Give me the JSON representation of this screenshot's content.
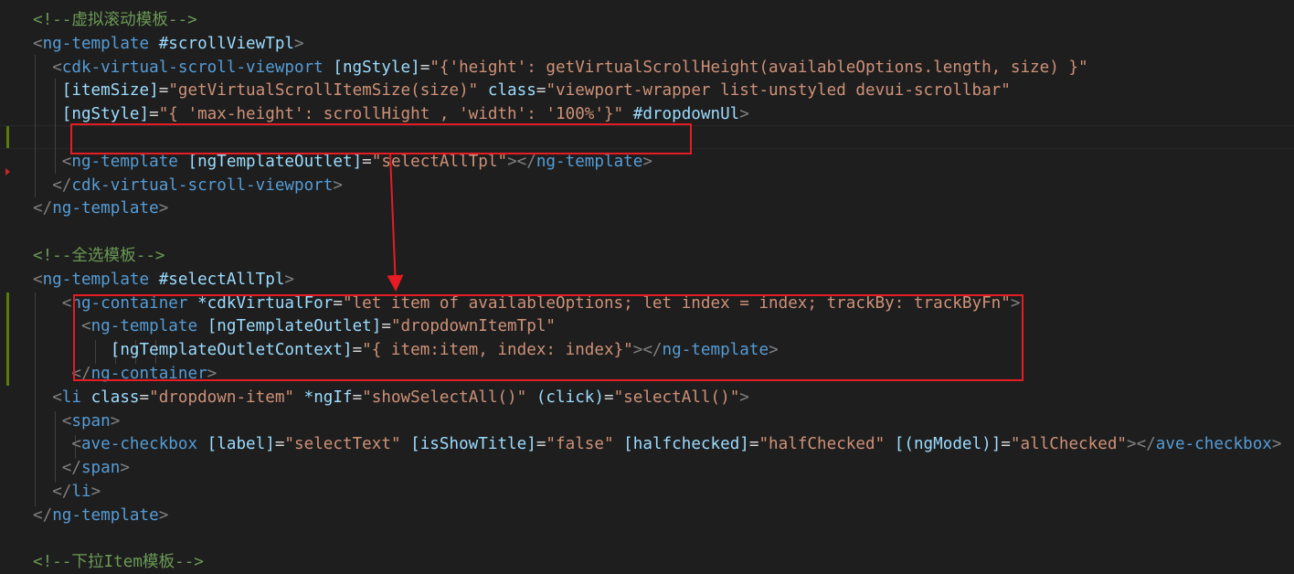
{
  "editor": {
    "lines": [
      [
        {
          "c": "c",
          "t": "<!--虚拟滚动模板-->"
        }
      ],
      [
        {
          "c": "pn",
          "t": "<"
        },
        {
          "c": "tg",
          "t": "ng-template"
        },
        {
          "c": "tx",
          "t": " "
        },
        {
          "c": "at",
          "t": "#scrollViewTpl"
        },
        {
          "c": "pn",
          "t": ">"
        }
      ],
      [
        {
          "c": "tx",
          "t": "  "
        },
        {
          "c": "pn",
          "t": "<"
        },
        {
          "c": "tg",
          "t": "cdk-virtual-scroll-viewport"
        },
        {
          "c": "tx",
          "t": " "
        },
        {
          "c": "at",
          "t": "[ngStyle]"
        },
        {
          "c": "tx",
          "t": "="
        },
        {
          "c": "st",
          "t": "\"{'height': getVirtualScrollHeight(availableOptions.length, size) }\""
        }
      ],
      [
        {
          "c": "tx",
          "t": "   "
        },
        {
          "c": "at",
          "t": "[itemSize]"
        },
        {
          "c": "tx",
          "t": "="
        },
        {
          "c": "st",
          "t": "\"getVirtualScrollItemSize(size)\""
        },
        {
          "c": "tx",
          "t": " "
        },
        {
          "c": "at",
          "t": "class"
        },
        {
          "c": "tx",
          "t": "="
        },
        {
          "c": "st",
          "t": "\"viewport-wrapper list-unstyled devui-scrollbar\""
        }
      ],
      [
        {
          "c": "tx",
          "t": "   "
        },
        {
          "c": "at",
          "t": "[ngStyle]"
        },
        {
          "c": "tx",
          "t": "="
        },
        {
          "c": "st",
          "t": "\"{ 'max-height': scrollHight , 'width': '100%'}\""
        },
        {
          "c": "tx",
          "t": " "
        },
        {
          "c": "at",
          "t": "#dropdownUl"
        },
        {
          "c": "pn",
          "t": ">"
        }
      ],
      [
        {
          "c": "tx",
          "t": ""
        }
      ],
      [
        {
          "c": "tx",
          "t": "   "
        },
        {
          "c": "pn",
          "t": "<"
        },
        {
          "c": "tg",
          "t": "ng-template"
        },
        {
          "c": "tx",
          "t": " "
        },
        {
          "c": "at",
          "t": "[ngTemplateOutlet]"
        },
        {
          "c": "tx",
          "t": "="
        },
        {
          "c": "st",
          "t": "\"selectAllTpl\""
        },
        {
          "c": "pn",
          "t": "></"
        },
        {
          "c": "tg",
          "t": "ng-template"
        },
        {
          "c": "pn",
          "t": ">"
        }
      ],
      [
        {
          "c": "tx",
          "t": "  "
        },
        {
          "c": "pn",
          "t": "</"
        },
        {
          "c": "tg",
          "t": "cdk-virtual-scroll-viewport"
        },
        {
          "c": "pn",
          "t": ">"
        }
      ],
      [
        {
          "c": "pn",
          "t": "</"
        },
        {
          "c": "tg",
          "t": "ng-template"
        },
        {
          "c": "pn",
          "t": ">"
        }
      ],
      [
        {
          "c": "tx",
          "t": ""
        }
      ],
      [
        {
          "c": "c",
          "t": "<!--全选模板-->"
        }
      ],
      [
        {
          "c": "pn",
          "t": "<"
        },
        {
          "c": "tg",
          "t": "ng-template"
        },
        {
          "c": "tx",
          "t": " "
        },
        {
          "c": "at",
          "t": "#selectAllTpl"
        },
        {
          "c": "pn",
          "t": ">"
        }
      ],
      [
        {
          "c": "tx",
          "t": "   "
        },
        {
          "c": "pn",
          "t": "<"
        },
        {
          "c": "tg",
          "t": "ng-container"
        },
        {
          "c": "tx",
          "t": " "
        },
        {
          "c": "at",
          "t": "*cdkVirtualFor"
        },
        {
          "c": "tx",
          "t": "="
        },
        {
          "c": "st",
          "t": "\"let item of availableOptions; let index = index; trackBy: trackByFn\""
        },
        {
          "c": "pn",
          "t": ">"
        }
      ],
      [
        {
          "c": "tx",
          "t": "     "
        },
        {
          "c": "pn",
          "t": "<"
        },
        {
          "c": "tg",
          "t": "ng-template"
        },
        {
          "c": "tx",
          "t": " "
        },
        {
          "c": "at",
          "t": "[ngTemplateOutlet]"
        },
        {
          "c": "tx",
          "t": "="
        },
        {
          "c": "st",
          "t": "\"dropdownItemTpl\""
        }
      ],
      [
        {
          "c": "tx",
          "t": "        "
        },
        {
          "c": "at",
          "t": "[ngTemplateOutletContext]"
        },
        {
          "c": "tx",
          "t": "="
        },
        {
          "c": "st",
          "t": "\"{ item:item, index: index}\""
        },
        {
          "c": "pn",
          "t": "></"
        },
        {
          "c": "tg",
          "t": "ng-template"
        },
        {
          "c": "pn",
          "t": ">"
        }
      ],
      [
        {
          "c": "tx",
          "t": "    "
        },
        {
          "c": "pn",
          "t": "</"
        },
        {
          "c": "tg",
          "t": "ng-container"
        },
        {
          "c": "pn",
          "t": ">"
        }
      ],
      [
        {
          "c": "tx",
          "t": "  "
        },
        {
          "c": "pn",
          "t": "<"
        },
        {
          "c": "tg",
          "t": "li"
        },
        {
          "c": "tx",
          "t": " "
        },
        {
          "c": "at",
          "t": "class"
        },
        {
          "c": "tx",
          "t": "="
        },
        {
          "c": "st",
          "t": "\"dropdown-item\""
        },
        {
          "c": "tx",
          "t": " "
        },
        {
          "c": "at",
          "t": "*ngIf"
        },
        {
          "c": "tx",
          "t": "="
        },
        {
          "c": "st",
          "t": "\"showSelectAll()\""
        },
        {
          "c": "tx",
          "t": " "
        },
        {
          "c": "at",
          "t": "(click)"
        },
        {
          "c": "tx",
          "t": "="
        },
        {
          "c": "st",
          "t": "\"selectAll()\""
        },
        {
          "c": "pn",
          "t": ">"
        }
      ],
      [
        {
          "c": "tx",
          "t": "   "
        },
        {
          "c": "pn",
          "t": "<"
        },
        {
          "c": "tg",
          "t": "span"
        },
        {
          "c": "pn",
          "t": ">"
        }
      ],
      [
        {
          "c": "tx",
          "t": "    "
        },
        {
          "c": "pn",
          "t": "<"
        },
        {
          "c": "tg",
          "t": "ave-checkbox"
        },
        {
          "c": "tx",
          "t": " "
        },
        {
          "c": "at",
          "t": "[label]"
        },
        {
          "c": "tx",
          "t": "="
        },
        {
          "c": "st",
          "t": "\"selectText\""
        },
        {
          "c": "tx",
          "t": " "
        },
        {
          "c": "at",
          "t": "[isShowTitle]"
        },
        {
          "c": "tx",
          "t": "="
        },
        {
          "c": "st",
          "t": "\"false\""
        },
        {
          "c": "tx",
          "t": " "
        },
        {
          "c": "at",
          "t": "[halfchecked]"
        },
        {
          "c": "tx",
          "t": "="
        },
        {
          "c": "st",
          "t": "\"halfChecked\""
        },
        {
          "c": "tx",
          "t": " "
        },
        {
          "c": "at",
          "t": "[(ngModel)]"
        },
        {
          "c": "tx",
          "t": "="
        },
        {
          "c": "st",
          "t": "\"allChecked\""
        },
        {
          "c": "pn",
          "t": "></"
        },
        {
          "c": "tg",
          "t": "ave-checkbox"
        },
        {
          "c": "pn",
          "t": ">"
        }
      ],
      [
        {
          "c": "tx",
          "t": "   "
        },
        {
          "c": "pn",
          "t": "</"
        },
        {
          "c": "tg",
          "t": "span"
        },
        {
          "c": "pn",
          "t": ">"
        }
      ],
      [
        {
          "c": "tx",
          "t": "  "
        },
        {
          "c": "pn",
          "t": "</"
        },
        {
          "c": "tg",
          "t": "li"
        },
        {
          "c": "pn",
          "t": ">"
        }
      ],
      [
        {
          "c": "pn",
          "t": "</"
        },
        {
          "c": "tg",
          "t": "ng-template"
        },
        {
          "c": "pn",
          "t": ">"
        }
      ],
      [
        {
          "c": "tx",
          "t": ""
        }
      ],
      [
        {
          "c": "c",
          "t": "<!--下拉Item模板-->"
        }
      ]
    ]
  },
  "theme": {
    "background": "#1e1e1e",
    "comment": "#6a9955",
    "tag": "#569cd6",
    "attribute": "#9cdcfe",
    "string": "#ce9178",
    "punctuation": "#808080",
    "annotation": "#e51c23"
  }
}
